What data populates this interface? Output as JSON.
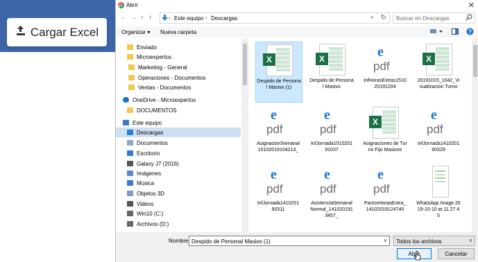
{
  "web": {
    "cargar_label": "Cargar Excel"
  },
  "dialog": {
    "title": "Abrir",
    "breadcrumb": [
      "Este equipo",
      "Descargas"
    ],
    "search_placeholder": "Buscar en Descargas",
    "toolbar": {
      "organizar": "Organizar",
      "nueva_carpeta": "Nueva carpeta"
    },
    "tree": [
      {
        "label": "Enviado",
        "icon": "folder-icon",
        "level": 1
      },
      {
        "label": "Microexpertos",
        "icon": "folder-icon",
        "level": 1
      },
      {
        "label": "Marketing - General",
        "icon": "folder-icon",
        "level": 2
      },
      {
        "label": "Operaciones - Documentos",
        "icon": "folder-icon",
        "level": 2
      },
      {
        "label": "Ventas - Documentos",
        "icon": "folder-icon",
        "level": 2
      },
      {
        "label": "OneDrive - Microexpertos",
        "icon": "cloud-icon",
        "level": 0
      },
      {
        "label": "DOCUMENTOS",
        "icon": "folder-icon",
        "level": 1
      },
      {
        "label": "Este equipo",
        "icon": "computer-icon",
        "level": 0
      },
      {
        "label": "Descargas",
        "icon": "download-icon",
        "level": 1,
        "selected": true
      },
      {
        "label": "Documentos",
        "icon": "documents-icon",
        "level": 1
      },
      {
        "label": "Escritorio",
        "icon": "desktop-icon",
        "level": 1
      },
      {
        "label": "Galaxy J7 (2016)",
        "icon": "phone-icon",
        "level": 1
      },
      {
        "label": "Imágenes",
        "icon": "pictures-icon",
        "level": 1
      },
      {
        "label": "Música",
        "icon": "music-icon",
        "level": 1
      },
      {
        "label": "Objetos 3D",
        "icon": "3d-objects-icon",
        "level": 1
      },
      {
        "label": "Videos",
        "icon": "video-icon",
        "level": 1
      },
      {
        "label": "Win10 (C:)",
        "icon": "drive-icon",
        "level": 1
      },
      {
        "label": "Archivos (D:)",
        "icon": "drive-icon",
        "level": 1
      }
    ],
    "files": [
      {
        "label": "Despido de Personal Masivo (1)",
        "type": "excel",
        "selected": true
      },
      {
        "label": "Despido de Personal Masivo",
        "type": "excel"
      },
      {
        "label": "InfHorasExtras151020191204",
        "type": "pdf"
      },
      {
        "label": "20191015_1042_Visualizacion Turno",
        "type": "excel"
      },
      {
        "label": "AsignacionSemanal15102019104213_",
        "type": "pdf"
      },
      {
        "label": "InfJornada151020191037",
        "type": "pdf"
      },
      {
        "label": "Asignaciones de Turno Fijo Masivos",
        "type": "excel"
      },
      {
        "label": "InfJornada141020190329",
        "type": "pdf"
      },
      {
        "label": "InfJornada141020190311",
        "type": "pdf"
      },
      {
        "label": "AsistenciaSemanalNormal_1410201913457_",
        "type": "pdf"
      },
      {
        "label": "PactosHorasExtra_14102019124740",
        "type": "pdf"
      },
      {
        "label": "WhatsApp Image 2019-10-10 at 11.27.45",
        "type": "image"
      }
    ],
    "nombre_label": "Nombre:",
    "nombre_value": "Despido de Personal Masivo (1)",
    "filter_value": "Todos los archivos",
    "abrir_label": "Abrir",
    "cancelar_label": "Cancelar"
  }
}
